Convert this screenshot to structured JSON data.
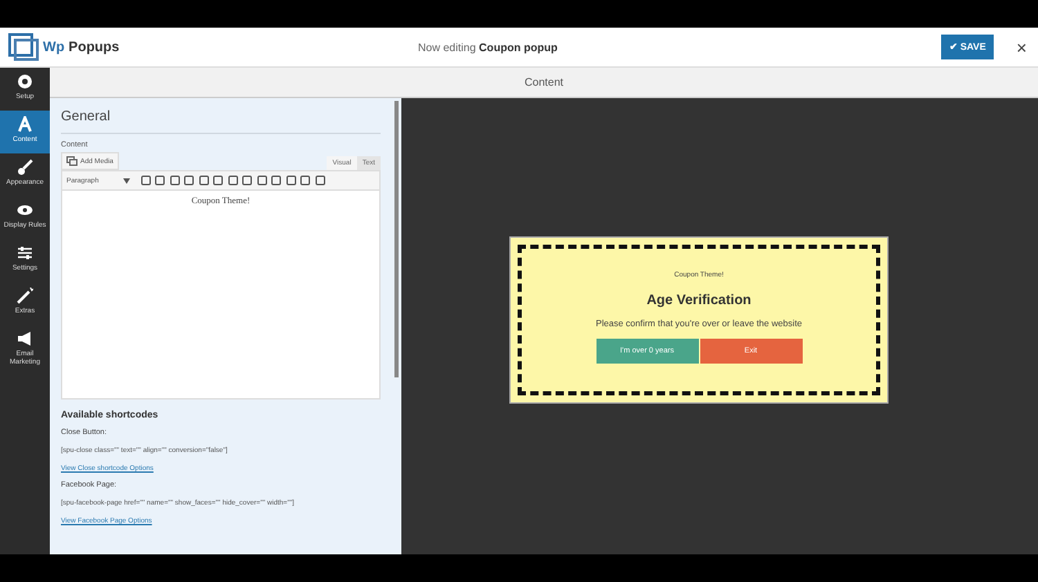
{
  "app": {
    "logo_text": "Wp",
    "title": "Popups"
  },
  "header": {
    "editing_label": "Now editing",
    "popup_name": "Coupon popup",
    "save_button": "✔ SAVE",
    "close": "×"
  },
  "sidebar": {
    "items": [
      {
        "label": "Setup",
        "kind": "gear",
        "selected": false
      },
      {
        "label": "Content",
        "kind": "letter",
        "selected": true
      },
      {
        "label": "Appearance",
        "kind": "brush",
        "selected": false
      },
      {
        "label": "Display Rules",
        "kind": "eye",
        "selected": false
      },
      {
        "label": "Settings",
        "kind": "sliders",
        "selected": false
      },
      {
        "label": "Extras",
        "kind": "wand",
        "selected": false
      },
      {
        "label": "Email Marketing",
        "kind": "megaphone",
        "selected": false
      }
    ]
  },
  "subheader": {
    "title": "Content"
  },
  "panel": {
    "section_title": "General",
    "field_label": "Content",
    "add_media": "Add Media",
    "editor_tabs": [
      {
        "label": "Visual",
        "selected": true
      },
      {
        "label": "Text",
        "selected": false
      }
    ],
    "format_select": "Paragraph",
    "editor_text": "Coupon Theme!",
    "shortcodes_title": "Available shortcodes",
    "shortcodes": [
      {
        "label": "Close Button:",
        "code": "[spu-close class=\"\" text=\"\" align=\"\" conversion=\"false\"]",
        "link": "View Close shortcode Options"
      },
      {
        "label": "Facebook Page:",
        "code": "[spu-facebook-page href=\"\" name=\"\" show_faces=\"\" hide_cover=\"\" width=\"\"]",
        "link": "View Facebook Page Options"
      }
    ]
  },
  "popup": {
    "small_text": "Coupon Theme!",
    "title": "Age Verification",
    "message": "Please confirm that you're over or leave the website",
    "buttons": [
      {
        "label": "I'm over 0 years",
        "color": "#4aa58a"
      },
      {
        "label": "Exit",
        "color": "#e5643f"
      }
    ]
  }
}
